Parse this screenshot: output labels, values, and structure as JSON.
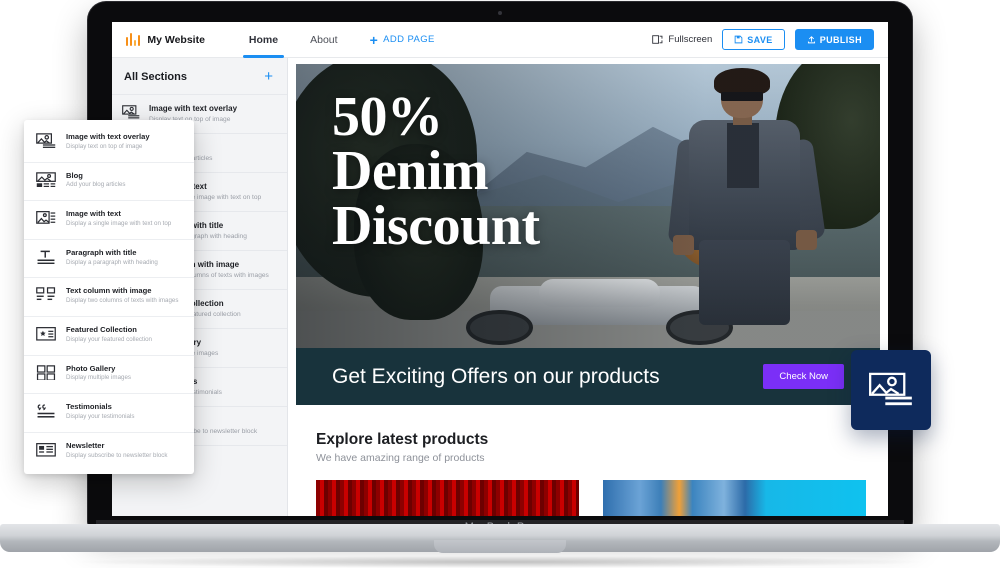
{
  "device": {
    "label": "MacBook Pro"
  },
  "topbar": {
    "brand": {
      "name": "My Website",
      "icon": "equalizer-bars-logo",
      "color": "#f79019"
    },
    "tabs": [
      {
        "label": "Home",
        "active": true
      },
      {
        "label": "About",
        "active": false
      }
    ],
    "add_page_label": "ADD PAGE",
    "fullscreen_label": "Fullscreen",
    "save_label": "SAVE",
    "publish_label": "PUBLISH",
    "accent_color": "#1b8ef2"
  },
  "sidebar": {
    "title": "All Sections",
    "add_icon": "plus-icon",
    "items": [
      {
        "title": "Image with text overlay",
        "desc": "Display text on top of image",
        "icon": "image-text-overlay-icon"
      },
      {
        "title": "Blog",
        "desc": "Add your blog articles",
        "icon": "blog-icon"
      },
      {
        "title": "Image with text",
        "desc": "Display a single image with text on top",
        "icon": "image-with-text-icon"
      },
      {
        "title": "Paragraph with title",
        "desc": "Display a paragraph with heading",
        "icon": "paragraph-title-icon"
      },
      {
        "title": "Text column with image",
        "desc": "Display two columns of texts with images",
        "icon": "text-column-image-icon"
      },
      {
        "title": "Featured Collection",
        "desc": "Display your featured collection",
        "icon": "featured-collection-icon"
      },
      {
        "title": "Photo Gallery",
        "desc": "Display multiple images",
        "icon": "photo-gallery-icon"
      },
      {
        "title": "Testimonials",
        "desc": "Display your testimonials",
        "icon": "testimonials-icon"
      },
      {
        "title": "Newsletter",
        "desc": "Display subscribe to newsletter block",
        "icon": "newsletter-icon"
      }
    ]
  },
  "dropdown": {
    "items": [
      {
        "title": "Image with text overlay",
        "desc": "Display text on top of image",
        "icon": "image-text-overlay-icon"
      },
      {
        "title": "Blog",
        "desc": "Add your blog articles",
        "icon": "blog-icon"
      },
      {
        "title": "Image with text",
        "desc": "Display a single image with text on top",
        "icon": "image-with-text-icon"
      },
      {
        "title": "Paragraph with title",
        "desc": "Display a paragraph with heading",
        "icon": "paragraph-title-icon"
      },
      {
        "title": "Text column with image",
        "desc": "Display two columns of texts with images",
        "icon": "text-column-image-icon"
      },
      {
        "title": "Featured Collection",
        "desc": "Display your featured collection",
        "icon": "featured-collection-icon"
      },
      {
        "title": "Photo Gallery",
        "desc": "Display multiple images",
        "icon": "photo-gallery-icon"
      },
      {
        "title": "Testimonials",
        "desc": "Display your testimonials",
        "icon": "testimonials-icon"
      },
      {
        "title": "Newsletter",
        "desc": "Display subscribe to newsletter block",
        "icon": "newsletter-icon"
      }
    ]
  },
  "canvas": {
    "hero": {
      "line1": "50%",
      "line2": "Denim",
      "line3": "Discount",
      "image_alt": "man-in-denim-jacket-on-motorcycle"
    },
    "cta": {
      "text": "Get Exciting Offers on our products",
      "button_label": "Check Now",
      "bg_color": "#18333c",
      "button_color": "#7b2ff7"
    },
    "explore": {
      "title": "Explore latest products",
      "subtitle": "We have amazing range of products",
      "products": [
        {
          "alt": "red-fabric-product"
        },
        {
          "alt": "blue-denim-product"
        }
      ]
    }
  },
  "badge": {
    "icon": "image-text-overlay-icon",
    "color": "#0e2a5c"
  }
}
